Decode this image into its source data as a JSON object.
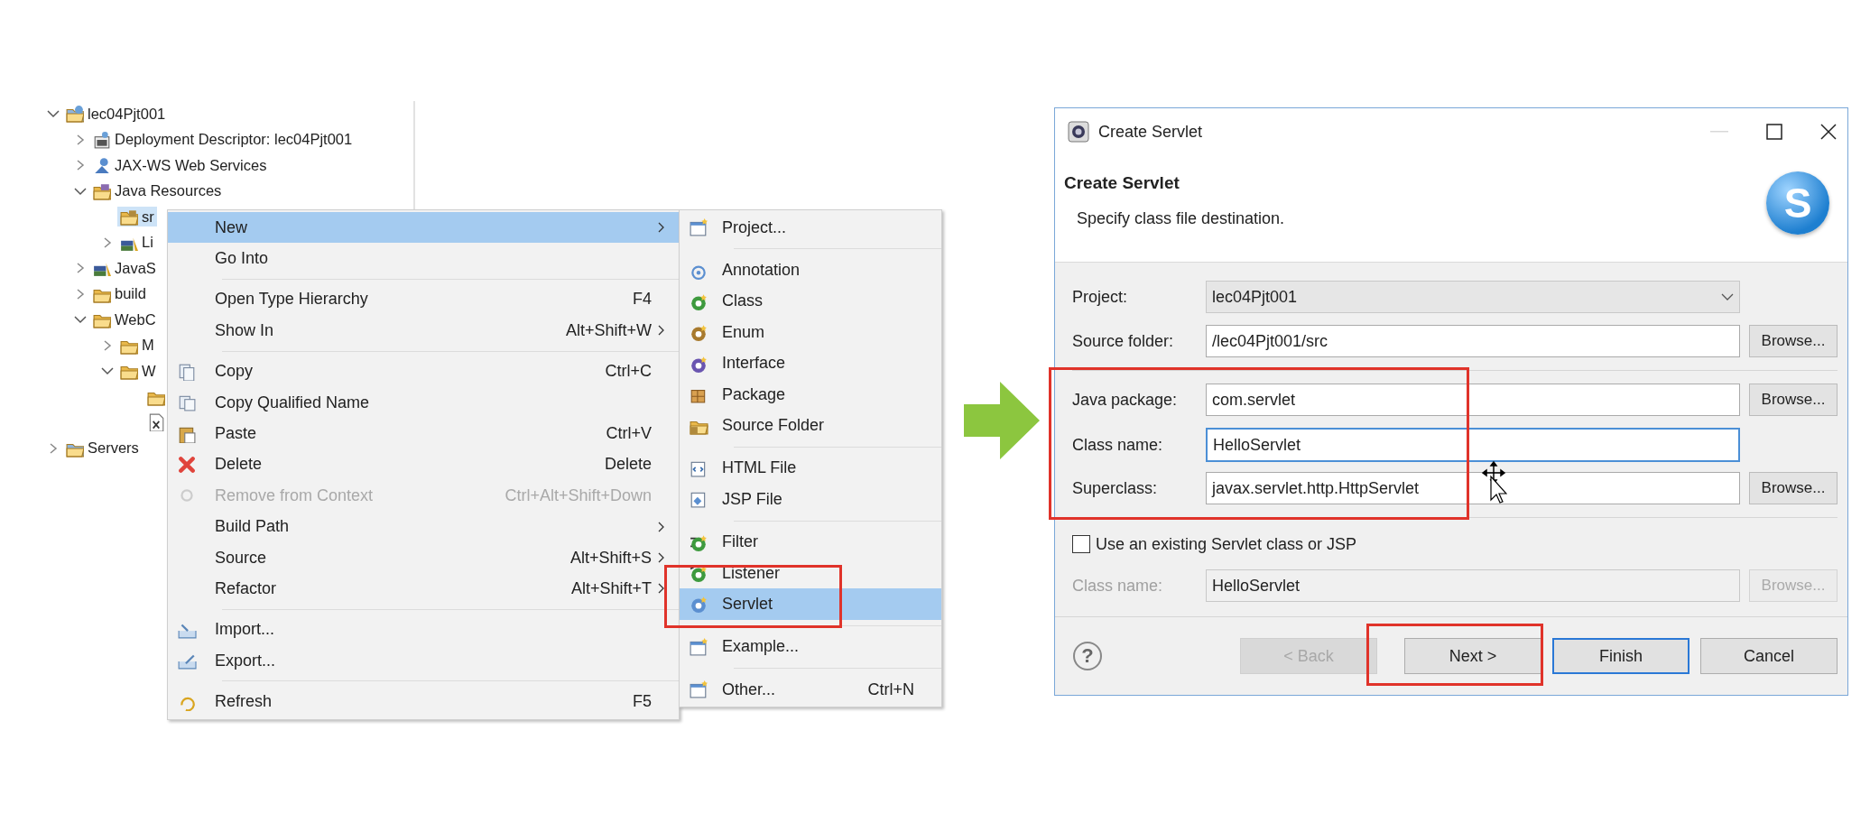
{
  "project_tree": [
    {
      "label": "lec04Pjt001",
      "kind": "project",
      "expanded": true,
      "selected": false,
      "children": [
        {
          "label": "Deployment Descriptor: lec04Pjt001",
          "kind": "descriptor",
          "expanded": false,
          "selected": false
        },
        {
          "label": "JAX-WS Web Services",
          "kind": "services",
          "expanded": false,
          "selected": false
        },
        {
          "label": "Java Resources",
          "kind": "resources",
          "expanded": true,
          "selected": false,
          "children": [
            {
              "label": "sr",
              "kind": "source",
              "selected": true
            },
            {
              "label": "Li",
              "kind": "library",
              "expanded": false,
              "selected": false
            }
          ]
        },
        {
          "label": "JavaS",
          "kind": "library",
          "expanded": false,
          "selected": false
        },
        {
          "label": "build",
          "kind": "folder",
          "expanded": false,
          "selected": false
        },
        {
          "label": "WebC",
          "kind": "folder",
          "expanded": true,
          "selected": false,
          "children": [
            {
              "label": "M",
              "kind": "folder",
              "expanded": false,
              "selected": false
            },
            {
              "label": "W",
              "kind": "folder",
              "expanded": true,
              "selected": false,
              "children": [
                {
                  "kind": "folder",
                  "selected": false
                },
                {
                  "kind": "file",
                  "selected": false
                }
              ]
            }
          ]
        }
      ]
    },
    {
      "label": "Servers",
      "kind": "servers",
      "expanded": false,
      "selected": false
    }
  ],
  "context_menu": {
    "groups": [
      {
        "items": [
          {
            "label": "New",
            "submenu": true,
            "selected": true,
            "disabled": false
          },
          {
            "label": "Go Into",
            "submenu": false,
            "selected": false,
            "disabled": false
          }
        ]
      },
      {
        "items": [
          {
            "label": "Open Type Hierarchy",
            "shortcut": "F4",
            "submenu": false,
            "selected": false,
            "disabled": false
          },
          {
            "label": "Show In",
            "shortcut": "Alt+Shift+W",
            "submenu": true,
            "selected": false,
            "disabled": false
          }
        ]
      },
      {
        "items": [
          {
            "label": "Copy",
            "shortcut": "Ctrl+C",
            "submenu": false,
            "selected": false,
            "disabled": false
          },
          {
            "label": "Copy Qualified Name",
            "submenu": false,
            "selected": false,
            "disabled": false
          },
          {
            "label": "Paste",
            "shortcut": "Ctrl+V",
            "submenu": false,
            "selected": false,
            "disabled": false
          },
          {
            "label": "Delete",
            "shortcut": "Delete",
            "submenu": false,
            "selected": false,
            "disabled": false
          },
          {
            "label": "Remove from Context",
            "shortcut": "Ctrl+Alt+Shift+Down",
            "submenu": false,
            "selected": false,
            "disabled": true
          },
          {
            "label": "Build Path",
            "submenu": true,
            "selected": false,
            "disabled": false
          },
          {
            "label": "Source",
            "shortcut": "Alt+Shift+S",
            "submenu": true,
            "selected": false,
            "disabled": false
          },
          {
            "label": "Refactor",
            "shortcut": "Alt+Shift+T",
            "submenu": true,
            "selected": false,
            "disabled": false
          }
        ]
      },
      {
        "items": [
          {
            "label": "Import...",
            "submenu": false,
            "selected": false,
            "disabled": false
          },
          {
            "label": "Export...",
            "submenu": false,
            "selected": false,
            "disabled": false
          }
        ]
      },
      {
        "items": [
          {
            "label": "Refresh",
            "shortcut": "F5",
            "submenu": false,
            "selected": false,
            "disabled": false
          }
        ]
      }
    ]
  },
  "new_submenu": {
    "groups": [
      {
        "items": [
          {
            "label": "Project...",
            "selected": false
          }
        ]
      },
      {
        "items": [
          {
            "label": "Annotation",
            "selected": false
          },
          {
            "label": "Class",
            "selected": false
          },
          {
            "label": "Enum",
            "selected": false
          },
          {
            "label": "Interface",
            "selected": false
          },
          {
            "label": "Package",
            "selected": false
          },
          {
            "label": "Source Folder",
            "selected": false
          }
        ]
      },
      {
        "items": [
          {
            "label": "HTML File",
            "selected": false
          },
          {
            "label": "JSP File",
            "selected": false
          }
        ]
      },
      {
        "items": [
          {
            "label": "Filter",
            "selected": false
          },
          {
            "label": "Listener",
            "selected": false
          },
          {
            "label": "Servlet",
            "selected": true
          }
        ]
      },
      {
        "items": [
          {
            "label": "Example...",
            "selected": false
          }
        ]
      },
      {
        "items": [
          {
            "label": "Other...",
            "shortcut": "Ctrl+N",
            "selected": false
          }
        ]
      }
    ]
  },
  "dialog": {
    "title": "Create Servlet",
    "header": {
      "title": "Create Servlet",
      "subtitle": "Specify class file destination.",
      "badge": "S"
    },
    "sections": [
      {
        "rows": [
          {
            "kind": "combo",
            "label": "Project:",
            "value": "lec04Pjt001"
          },
          {
            "kind": "text",
            "label": "Source folder:",
            "value": "/lec04Pjt001/src",
            "disabled": false,
            "focused": false,
            "browse": {
              "label": "Browse...",
              "disabled": false
            }
          }
        ]
      },
      {
        "rows": [
          {
            "kind": "text",
            "label": "Java package:",
            "value": "com.servlet",
            "disabled": false,
            "focused": false,
            "browse": {
              "label": "Browse...",
              "disabled": false
            }
          },
          {
            "kind": "text",
            "label": "Class name:",
            "value": "HelloServlet",
            "disabled": false,
            "focused": true
          },
          {
            "kind": "text",
            "label": "Superclass:",
            "value": "javax.servlet.http.HttpServlet",
            "disabled": false,
            "focused": false,
            "browse": {
              "label": "Browse...",
              "disabled": false
            }
          }
        ]
      },
      {
        "rows": [
          {
            "kind": "checkbox",
            "label": "Use an existing Servlet class or JSP",
            "checked": false
          },
          {
            "kind": "text",
            "label": "Class name:",
            "value": "HelloServlet",
            "disabled": true,
            "focused": false,
            "browse": {
              "label": "Browse...",
              "disabled": true
            }
          }
        ]
      }
    ],
    "help": "?",
    "buttons": [
      {
        "label": "< Back",
        "disabled": true,
        "default": false
      },
      {
        "label": "Next >",
        "disabled": false,
        "default": false
      },
      {
        "label": "Finish",
        "disabled": false,
        "default": true
      },
      {
        "label": "Cancel",
        "disabled": false,
        "default": false
      }
    ]
  }
}
